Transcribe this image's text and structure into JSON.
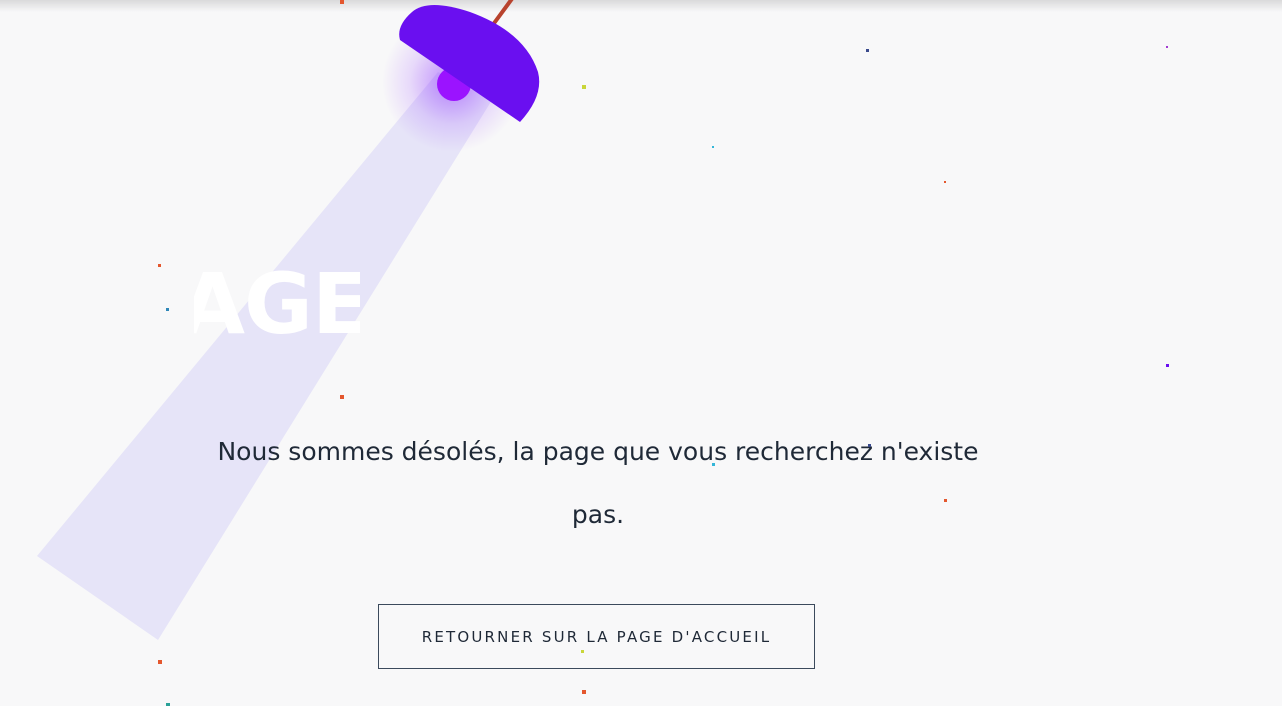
{
  "hero": {
    "headline_fragment": "AGE"
  },
  "message": {
    "text": "Nous sommes désolés, la page que vous recherchez n'existe pas."
  },
  "cta": {
    "label": "RETOURNER SUR LA PAGE D'ACCUEIL"
  },
  "colors": {
    "background": "#f8f8f9",
    "lamp": "#6a0ff0",
    "lamp_bulb": "#9b13ff",
    "beam": "#e6e4f8",
    "cord": "#b8432e",
    "text": "#1f2937",
    "button_border": "#3b4a5c"
  },
  "icons": {
    "lamp": "lamp-icon"
  }
}
